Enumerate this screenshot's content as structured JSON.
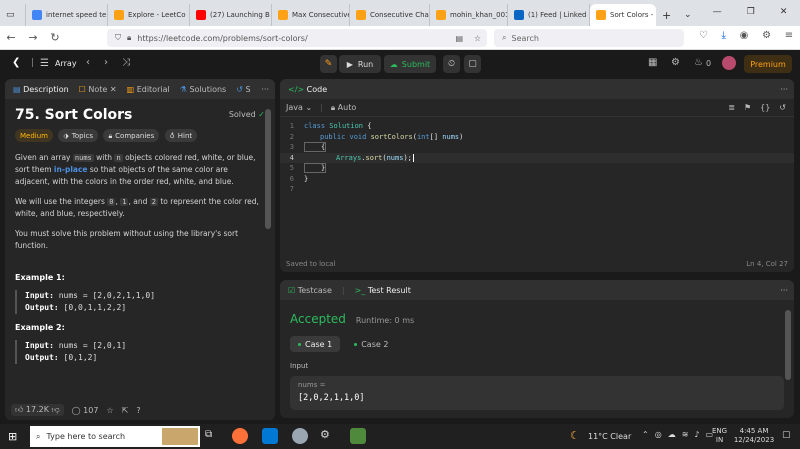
{
  "browser": {
    "tabs": [
      {
        "label": "internet speed te",
        "color": "#4285f4"
      },
      {
        "label": "Explore - LeetCo",
        "color": "#ffa116"
      },
      {
        "label": "(27) Launching B",
        "color": "#ff0000"
      },
      {
        "label": "Max Consecutive",
        "color": "#ffa116"
      },
      {
        "label": "Consecutive Cha",
        "color": "#ffa116"
      },
      {
        "label": "mohin_khan_001",
        "color": "#ffa116"
      },
      {
        "label": "(1) Feed | Linked",
        "color": "#0a66c2"
      },
      {
        "label": "Sort Colors - L",
        "color": "#ffa116"
      }
    ],
    "url": "https://leetcode.com/problems/sort-colors/",
    "search_placeholder": "Search"
  },
  "header": {
    "problem_list": "Array",
    "run": "Run",
    "submit": "Submit",
    "streak": "0",
    "premium": "Premium"
  },
  "left_panel": {
    "tabs": [
      "Description",
      "Note",
      "Editorial",
      "Solutions",
      "S"
    ],
    "title": "75. Sort Colors",
    "status": "Solved",
    "tags": [
      "Medium",
      "Topics",
      "Companies",
      "Hint"
    ],
    "p1a": "Given an array",
    "p1code1": "nums",
    "p1b": "with",
    "p1code2": "n",
    "p1c": "objects colored red, white, or blue, sort them",
    "p1link": "in-place",
    "p1d": "so that objects of the same color are adjacent, with the colors in the order red, white, and blue.",
    "p2a": "We will use the integers",
    "c0": "0",
    "c1": "1",
    "p2b": ", and",
    "c2": "2",
    "p2c": "to represent the color red, white, and blue, respectively.",
    "p3": "You must solve this problem without using the library's sort function.",
    "ex1_title": "Example 1:",
    "ex1_in_label": "Input:",
    "ex1_in": "nums = [2,0,2,1,1,0]",
    "ex1_out_label": "Output:",
    "ex1_out": "[0,0,1,1,2,2]",
    "ex2_title": "Example 2:",
    "ex2_in_label": "Input:",
    "ex2_in": "nums = [2,0,1]",
    "ex2_out_label": "Output:",
    "ex2_out": "[0,1,2]",
    "likes": "17.2K",
    "comments": "107"
  },
  "code_panel": {
    "tab": "Code",
    "language": "Java",
    "mode": "Auto",
    "saved": "Saved to local",
    "cursor": "Ln 4, Col 27",
    "lines": [
      "1",
      "2",
      "3",
      "4",
      "5",
      "6",
      "7"
    ]
  },
  "result_panel": {
    "tabs": [
      "Testcase",
      "Test Result"
    ],
    "verdict": "Accepted",
    "runtime": "Runtime: 0 ms",
    "cases": [
      "Case 1",
      "Case 2"
    ],
    "input_label": "Input",
    "var_label": "nums =",
    "var_value": "[2,0,2,1,1,0]"
  },
  "taskbar": {
    "search": "Type here to search",
    "weather": "11°C  Clear",
    "lang": "ENG",
    "region": "IN",
    "time": "4:45 AM",
    "date": "12/24/2023"
  }
}
